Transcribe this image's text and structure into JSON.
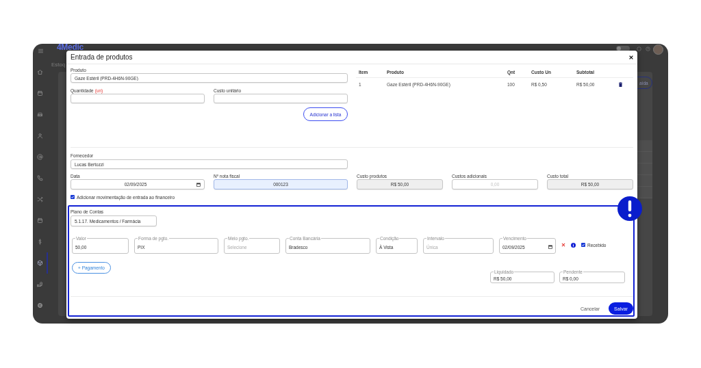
{
  "app": {
    "logo": "4Medic",
    "breadcrumb": "Estoq",
    "background_button": "aída",
    "toggle_on": false
  },
  "sidebar": {
    "items": [
      {
        "kind": "home",
        "selected": false
      },
      {
        "kind": "calendar",
        "selected": false
      },
      {
        "kind": "car",
        "selected": false
      },
      {
        "kind": "person",
        "selected": false
      },
      {
        "kind": "at",
        "selected": false
      },
      {
        "kind": "phone",
        "selected": false
      },
      {
        "kind": "shuffle",
        "selected": false
      },
      {
        "kind": "calendar",
        "selected": false
      },
      {
        "kind": "dollar",
        "selected": false
      },
      {
        "kind": "cube",
        "selected": true
      },
      {
        "kind": "hand",
        "selected": false
      },
      {
        "kind": "gear",
        "selected": false
      }
    ]
  },
  "dialog": {
    "title": "Entrada de produtos",
    "product": {
      "label": "Produto",
      "value": "Gaze Estéril (PRD-4H6N-90GE)"
    },
    "quantity": {
      "label": "Quantidade",
      "unit": "(un)"
    },
    "unit_cost": {
      "label": "Custo unitário"
    },
    "add_button": "Adicionar a lista",
    "items_table": {
      "columns": [
        "Item",
        "Produto",
        "Qnt",
        "Custo Un",
        "Subtotal"
      ],
      "rows": [
        {
          "cells": [
            "1",
            "Gaze Estéril (PRD-4H6N-90GE)",
            "100",
            "R$ 0,50",
            "R$ 50,00"
          ]
        }
      ]
    },
    "supplier": {
      "label": "Fornecedor",
      "value": "Lucas Bertozzi"
    },
    "summary_fields": [
      {
        "kind": "date",
        "label": "Data",
        "value": "02/09/2025",
        "disabled": false,
        "focused": false
      },
      {
        "kind": "text",
        "label": "Nº nota fiscal",
        "value": "000123",
        "disabled": false,
        "focused": true
      },
      {
        "kind": "text",
        "label": "Custo produtos",
        "value": "R$ 50,00",
        "disabled": true,
        "focused": false
      },
      {
        "kind": "text",
        "label": "Custos adicionais",
        "placeholder": "0,00",
        "disabled": false,
        "focused": false
      },
      {
        "kind": "text",
        "label": "Custo total",
        "value": "R$ 50,00",
        "disabled": true,
        "focused": false
      }
    ],
    "finance_option": {
      "label": "Adicionar movimentação de entrada ao financeiro",
      "checked": true
    },
    "account_plan": {
      "label": "Plano de Contas",
      "value": "5.1.17. Medicamentos / Farmácia"
    },
    "payments": [
      {
        "fields": [
          {
            "kind": "text",
            "label": "Valor",
            "value": "50,00"
          },
          {
            "kind": "text",
            "label": "Forma de pgto.",
            "value": "PIX"
          },
          {
            "kind": "text",
            "label": "Meio pgto.",
            "placeholder": "Selecione"
          },
          {
            "kind": "text",
            "label": "Conta Bancária",
            "value": "Bradesco"
          },
          {
            "kind": "text",
            "label": "Condição",
            "value": "À Vista"
          },
          {
            "kind": "text",
            "label": "Intervalo",
            "placeholder": "Única"
          },
          {
            "kind": "date",
            "label": "Vencimento",
            "value": "02/09/2025"
          }
        ],
        "received_label": "Recebido",
        "received": true
      }
    ],
    "add_payment_button": "+ Pagamento",
    "totals": [
      {
        "label": "Liquidado",
        "value": "R$ 50,00"
      },
      {
        "label": "Pendente",
        "value": "R$ 0,00"
      }
    ],
    "buttons": [
      {
        "kind": "text",
        "label": "Cancelar"
      },
      {
        "kind": "filled",
        "label": "Salvar"
      }
    ]
  }
}
